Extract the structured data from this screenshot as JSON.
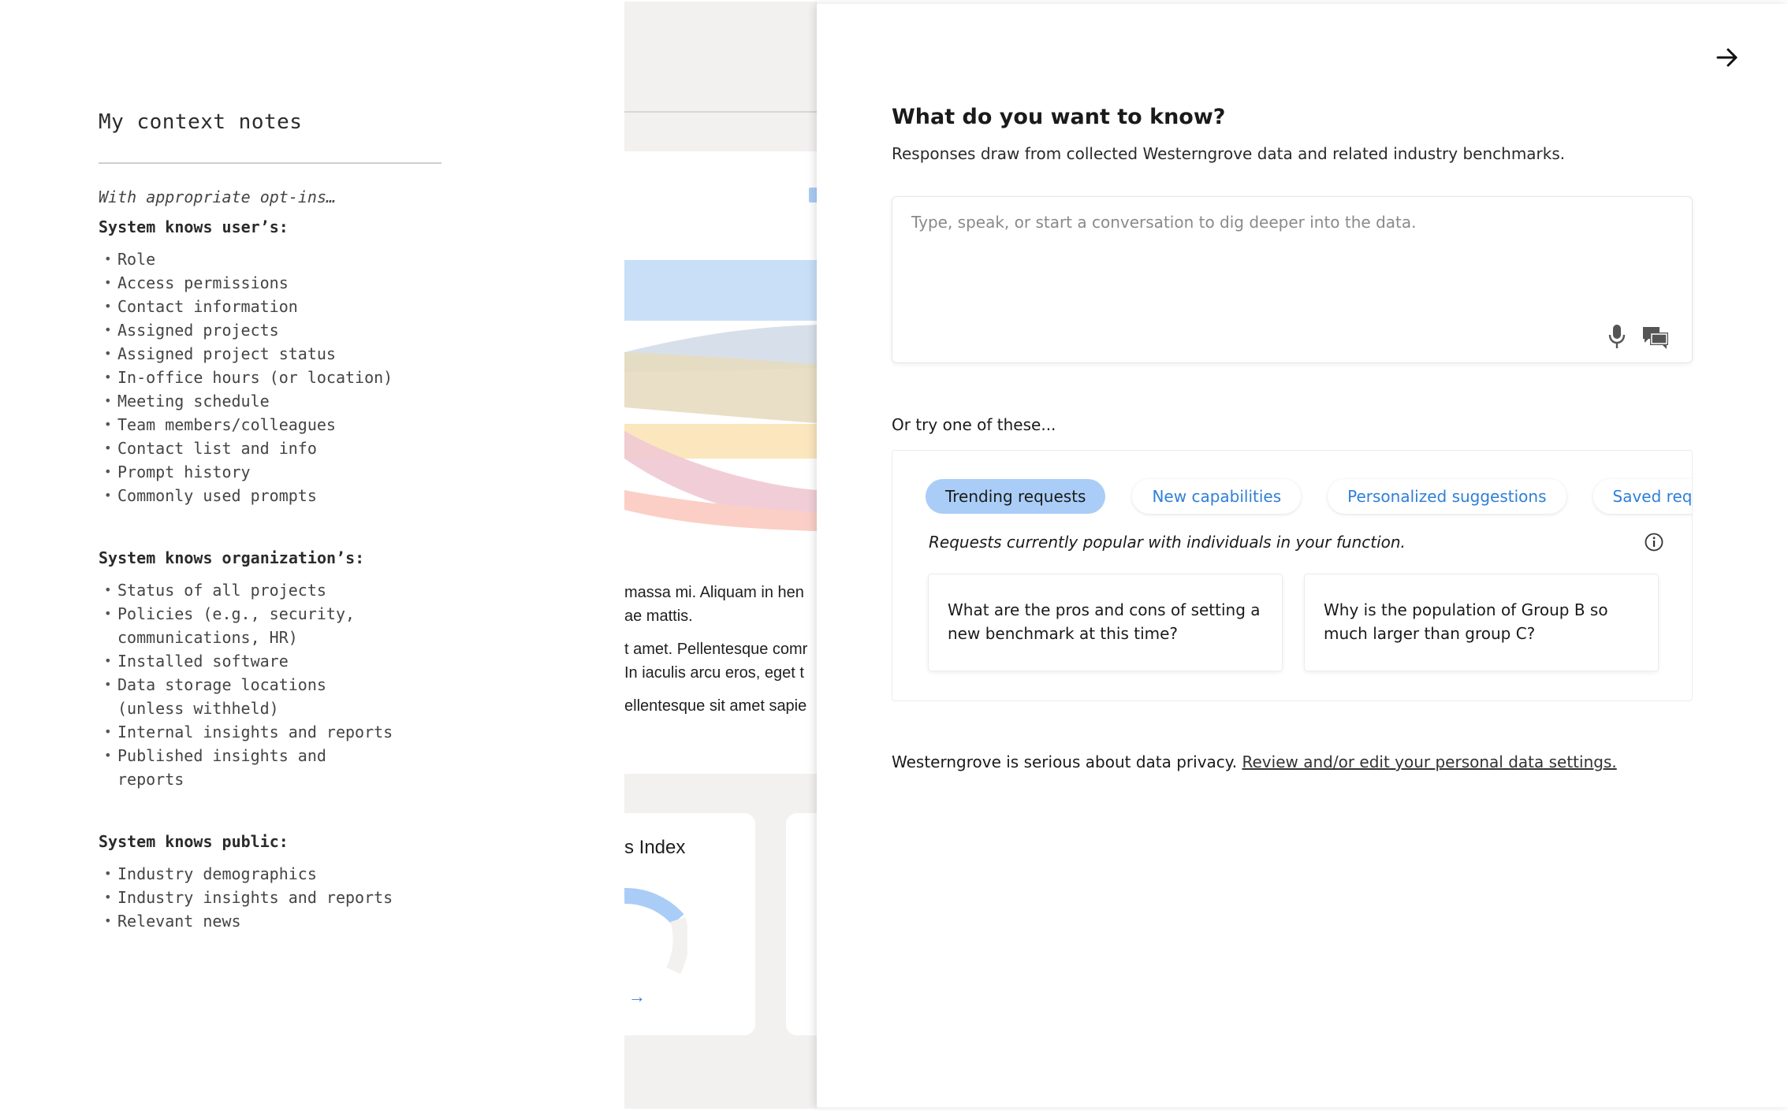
{
  "notes": {
    "title": "My context notes",
    "intro": "With appropriate opt-ins…",
    "sections": [
      {
        "title": "System knows user’s:",
        "items": [
          "Role",
          "Access permissions",
          "Contact information",
          "Assigned projects",
          "Assigned project status",
          "In-office hours (or location)",
          "Meeting schedule",
          "Team members/colleagues",
          "Contact list and info",
          "Prompt history",
          "Commonly used prompts"
        ]
      },
      {
        "title": "System knows organization’s:",
        "items": [
          "Status of all projects",
          "Policies (e.g., security,",
          "communications, HR)",
          "Installed software",
          "Data storage locations",
          "(unless withheld)",
          "Internal insights and reports",
          "Published insights and",
          "reports"
        ]
      },
      {
        "title": "System knows public:",
        "items": [
          "Industry demographics",
          "Industry insights and reports",
          "Relevant news"
        ]
      }
    ]
  },
  "background_app": {
    "lorem_lines": [
      "massa mi. Aliquam in hen",
      "ae mattis.",
      "t amet. Pellentesque comr",
      "In iaculis arcu eros, eget t",
      "ellentesque sit amet sapie"
    ],
    "tile_title": "s Index",
    "tile_link": "→",
    "flow_colors": [
      "#c9dff8",
      "#d7e0ea",
      "#e7dcc0",
      "#fbe6bd",
      "#f0c9d3",
      "#fbcfc6"
    ],
    "gauge_color": "#a9cdf6"
  },
  "panel": {
    "close_icon": "arrow-right-icon",
    "title": "What do you want to know?",
    "subtitle": "Responses draw from collected Westerngrove data and related industry benchmarks.",
    "input_placeholder": "Type, speak, or start a conversation to dig deeper into the data.",
    "try_label": "Or try one of these...",
    "tabs": [
      "Trending requests",
      "New capabilities",
      "Personalized suggestions",
      "Saved requests"
    ],
    "active_tab": "Trending requests",
    "tab_description": "Requests currently popular with individuals in your function.",
    "suggestions": [
      "What are the pros and cons of setting a new benchmark at this time?",
      "Why is the population of Group B so much larger than group C?"
    ],
    "privacy_text": "Westerngrove is serious about data privacy.",
    "privacy_link": "Review and/or edit your personal data settings.",
    "accent_color": "#a9cdf6",
    "link_color": "#2f7fd8"
  }
}
